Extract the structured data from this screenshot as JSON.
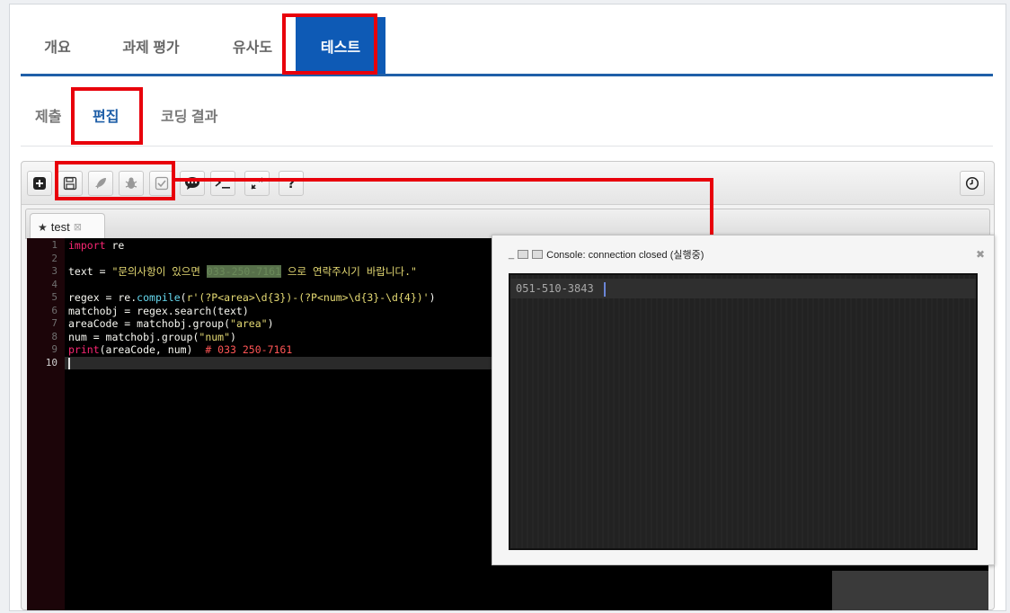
{
  "main_tabs": [
    "개요",
    "과제 평가",
    "유사도",
    "테스트"
  ],
  "sub_tabs": [
    "제출",
    "편집",
    "코딩 결과"
  ],
  "editor": {
    "file_tab": "test",
    "line_numbers": [
      "1",
      "2",
      "3",
      "4",
      "5",
      "6",
      "7",
      "8",
      "9",
      "10"
    ],
    "code": {
      "l1_kw": "import",
      "l1_rest": " re",
      "l3_a": "text = ",
      "l3_str1": "\"문의사항이 있으면 ",
      "l3_phone": "033-250-7161",
      "l3_str2": " 으로 연락주시기 바랍니다.\"",
      "l5_a": "regex = re.",
      "l5_fn": "compile",
      "l5_b": "(",
      "l5_str": "r'(?P<area>\\d{3})-(?P<num>\\d{3}-\\d{4})'",
      "l5_c": ")",
      "l6": "matchobj = regex.search(text)",
      "l7_a": "areaCode = matchobj.group(",
      "l7_str": "\"area\"",
      "l7_b": ")",
      "l8_a": "num = matchobj.group(",
      "l8_str": "\"num\"",
      "l8_b": ")",
      "l9_kw": "print",
      "l9_a": "(areaCode, num)  ",
      "l9_cm": "# 033 250-7161"
    }
  },
  "console": {
    "title": "Console: connection closed (실행중)",
    "close": "✖",
    "output": "051-510-3843"
  },
  "icons": [
    "add-file-icon",
    "save-icon",
    "rocket-icon",
    "bug-icon",
    "check-icon",
    "chat-icon",
    "terminal-icon",
    "expand-icon",
    "help-icon",
    "clock-icon"
  ],
  "colors": {
    "accent": "#0e5ab5",
    "highlight": "#e8000b",
    "editor_bg": "#000000"
  }
}
